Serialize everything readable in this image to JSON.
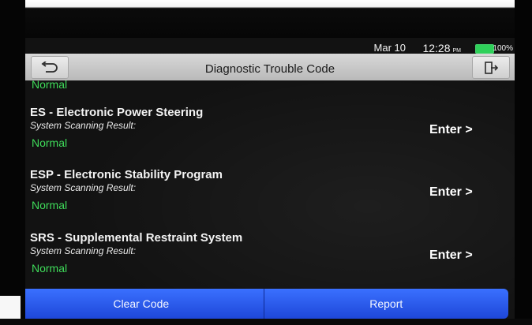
{
  "statusbar": {
    "date": "Mar 10",
    "time": "12:28",
    "ampm": "PM",
    "battery": "100%"
  },
  "header": {
    "title": "Diagnostic Trouble Code"
  },
  "partial_item": {
    "status": "Normal"
  },
  "systems": [
    {
      "title": "ES - Electronic Power Steering",
      "subtitle": "System Scanning Result:",
      "status": "Normal",
      "enter": "Enter >"
    },
    {
      "title": "ESP - Electronic Stability Program",
      "subtitle": "System Scanning Result:",
      "status": "Normal",
      "enter": "Enter >"
    },
    {
      "title": "SRS - Supplemental Restraint System",
      "subtitle": "System Scanning Result:",
      "status": "Normal",
      "enter": "Enter >"
    }
  ],
  "footer": {
    "clear_label": "Clear Code",
    "report_label": "Report"
  },
  "colors": {
    "accent_blue": "#2a5cf2",
    "status_green": "#3fdc5a"
  },
  "icons": {
    "back": "return-arrow-icon",
    "exit": "exit-door-icon",
    "battery": "battery-icon"
  }
}
